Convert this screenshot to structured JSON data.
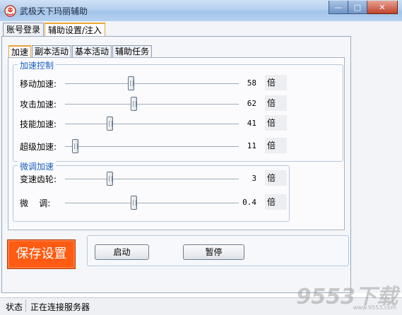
{
  "window": {
    "title": "武极天下玛丽辅助",
    "min_label": "—",
    "max_label": "□",
    "close_label": "✕"
  },
  "main_tabs": [
    {
      "label": "账号登录"
    },
    {
      "label": "辅助设置/注入"
    }
  ],
  "sub_tabs": [
    {
      "label": "加速"
    },
    {
      "label": "副本活动"
    },
    {
      "label": "基本活动"
    },
    {
      "label": "辅助任务"
    }
  ],
  "accel_group": {
    "title": "加速控制",
    "rows": [
      {
        "label": "移动加速:",
        "value": "58",
        "unit": "倍",
        "slider_fraction": 0.36
      },
      {
        "label": "攻击加速:",
        "value": "62",
        "unit": "倍",
        "slider_fraction": 0.38
      },
      {
        "label": "技能加速:",
        "value": "41",
        "unit": "倍",
        "slider_fraction": 0.24
      },
      {
        "label": "超级加速:",
        "value": "11",
        "unit": "倍",
        "slider_fraction": 0.04
      }
    ]
  },
  "fine_group": {
    "title": "微调加速",
    "rows": [
      {
        "label": "变速齿轮:",
        "value": "3",
        "unit": "倍",
        "slider_fraction": 0.24
      },
      {
        "label": "微    调:",
        "value": "0.4",
        "unit": "倍",
        "slider_fraction": 0.38
      }
    ]
  },
  "buttons": {
    "save": "保存设置",
    "start": "启动",
    "pause": "暂停"
  },
  "status": {
    "label": "状态",
    "text": "正在连接服务器"
  },
  "watermark": {
    "text": "9553下载",
    "url": "www.9553.com"
  },
  "colors": {
    "accent": "#f0a830",
    "save_button": "#ff5b12",
    "group_title": "#1a5fbf"
  }
}
